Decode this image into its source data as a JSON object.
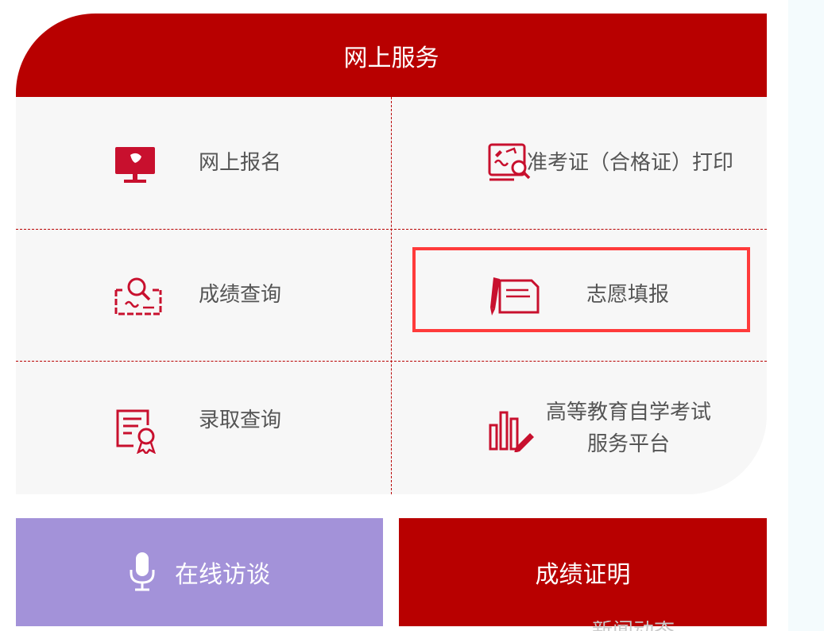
{
  "panel": {
    "title": "网上服务"
  },
  "services": [
    {
      "label": "网上报名",
      "icon": "monitor-icon"
    },
    {
      "label": "准考证（合格证）打印",
      "icon": "ticket-search-icon"
    },
    {
      "label": "成绩查询",
      "icon": "score-search-icon"
    },
    {
      "label": "志愿填报",
      "icon": "pen-form-icon"
    },
    {
      "label": "录取查询",
      "icon": "certificate-icon"
    },
    {
      "label": "高等教育自学考试服务平台",
      "icon": "bar-chart-pen-icon"
    }
  ],
  "buttons": {
    "interview": "在线访谈",
    "certificate": "成绩证明"
  },
  "footer": {
    "partial_text": "新闻动态"
  },
  "colors": {
    "brand_red": "#b80000",
    "interview_purple": "#a392d9",
    "highlight": "#ff3b3b"
  }
}
